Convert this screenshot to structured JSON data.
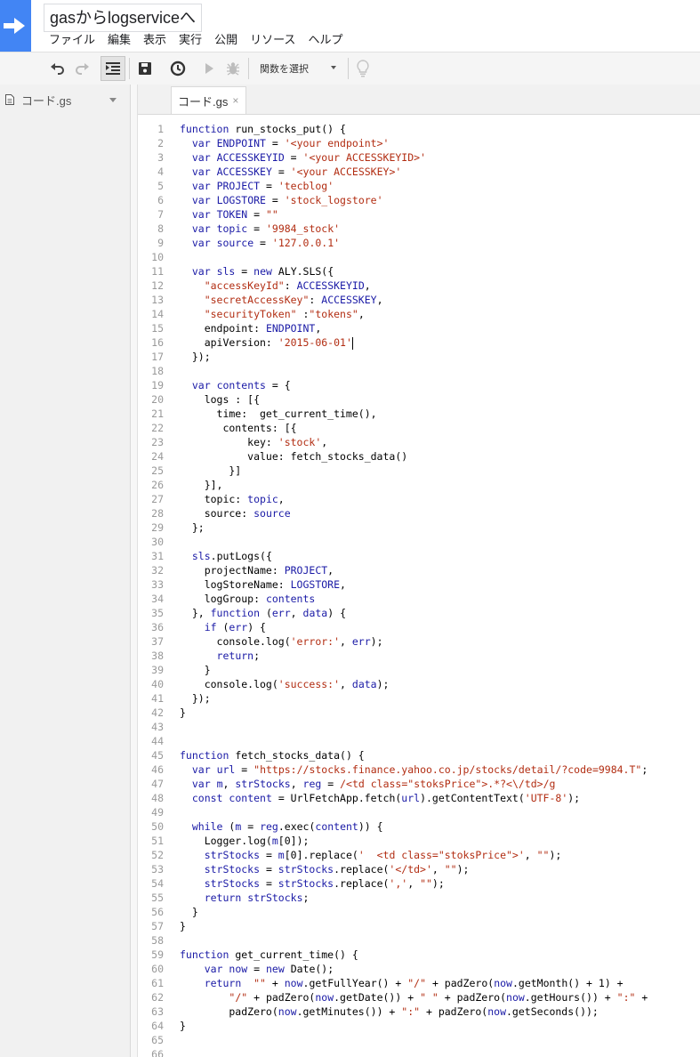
{
  "app": {
    "title": "gasからlogserviceへ",
    "menu": [
      "ファイル",
      "編集",
      "表示",
      "実行",
      "公開",
      "リソース",
      "ヘルプ"
    ]
  },
  "toolbar": {
    "function_select": "関数を選択"
  },
  "sidebar": {
    "files": [
      {
        "name": "コード.gs"
      }
    ]
  },
  "tabs": [
    {
      "label": "コード.gs",
      "close": "×"
    }
  ],
  "code": {
    "lines": [
      [
        [
          "k",
          "function"
        ],
        [
          "p",
          " run_stocks_put() {"
        ]
      ],
      [
        [
          "p",
          "  "
        ],
        [
          "k",
          "var"
        ],
        [
          "p",
          " "
        ],
        [
          "v",
          "ENDPOINT"
        ],
        [
          "p",
          " = "
        ],
        [
          "s",
          "'<your endpoint>'"
        ]
      ],
      [
        [
          "p",
          "  "
        ],
        [
          "k",
          "var"
        ],
        [
          "p",
          " "
        ],
        [
          "v",
          "ACCESSKEYID"
        ],
        [
          "p",
          " = "
        ],
        [
          "s",
          "'<your ACCESSKEYID>'"
        ]
      ],
      [
        [
          "p",
          "  "
        ],
        [
          "k",
          "var"
        ],
        [
          "p",
          " "
        ],
        [
          "v",
          "ACCESSKEY"
        ],
        [
          "p",
          " = "
        ],
        [
          "s",
          "'<your ACCESSKEY>'"
        ]
      ],
      [
        [
          "p",
          "  "
        ],
        [
          "k",
          "var"
        ],
        [
          "p",
          " "
        ],
        [
          "v",
          "PROJECT"
        ],
        [
          "p",
          " = "
        ],
        [
          "s",
          "'tecblog'"
        ]
      ],
      [
        [
          "p",
          "  "
        ],
        [
          "k",
          "var"
        ],
        [
          "p",
          " "
        ],
        [
          "v",
          "LOGSTORE"
        ],
        [
          "p",
          " = "
        ],
        [
          "s",
          "'stock_logstore'"
        ]
      ],
      [
        [
          "p",
          "  "
        ],
        [
          "k",
          "var"
        ],
        [
          "p",
          " "
        ],
        [
          "v",
          "TOKEN"
        ],
        [
          "p",
          " = "
        ],
        [
          "s",
          "\"\""
        ]
      ],
      [
        [
          "p",
          "  "
        ],
        [
          "k",
          "var"
        ],
        [
          "p",
          " "
        ],
        [
          "v",
          "topic"
        ],
        [
          "p",
          " = "
        ],
        [
          "s",
          "'9984_stock'"
        ]
      ],
      [
        [
          "p",
          "  "
        ],
        [
          "k",
          "var"
        ],
        [
          "p",
          " "
        ],
        [
          "v",
          "source"
        ],
        [
          "p",
          " = "
        ],
        [
          "s",
          "'127.0.0.1'"
        ]
      ],
      [],
      [
        [
          "p",
          "  "
        ],
        [
          "k",
          "var"
        ],
        [
          "p",
          " "
        ],
        [
          "v",
          "sls"
        ],
        [
          "p",
          " = "
        ],
        [
          "k",
          "new"
        ],
        [
          "p",
          " ALY.SLS({"
        ]
      ],
      [
        [
          "p",
          "    "
        ],
        [
          "s",
          "\"accessKeyId\""
        ],
        [
          "p",
          ": "
        ],
        [
          "v",
          "ACCESSKEYID"
        ],
        [
          "p",
          ","
        ]
      ],
      [
        [
          "p",
          "    "
        ],
        [
          "s",
          "\"secretAccessKey\""
        ],
        [
          "p",
          ": "
        ],
        [
          "v",
          "ACCESSKEY"
        ],
        [
          "p",
          ","
        ]
      ],
      [
        [
          "p",
          "    "
        ],
        [
          "s",
          "\"securityToken\""
        ],
        [
          "p",
          " :"
        ],
        [
          "s",
          "\"tokens\""
        ],
        [
          "p",
          ","
        ]
      ],
      [
        [
          "p",
          "    endpoint: "
        ],
        [
          "v",
          "ENDPOINT"
        ],
        [
          "p",
          ","
        ]
      ],
      [
        [
          "p",
          "    apiVersion: "
        ],
        [
          "s",
          "'2015-06-01'"
        ],
        [
          "c",
          ""
        ]
      ],
      [
        [
          "p",
          "  });"
        ]
      ],
      [],
      [
        [
          "p",
          "  "
        ],
        [
          "k",
          "var"
        ],
        [
          "p",
          " "
        ],
        [
          "v",
          "contents"
        ],
        [
          "p",
          " = {"
        ]
      ],
      [
        [
          "p",
          "    logs : [{"
        ]
      ],
      [
        [
          "p",
          "      time:  get_current_time(),"
        ]
      ],
      [
        [
          "p",
          "       contents: [{"
        ]
      ],
      [
        [
          "p",
          "           key: "
        ],
        [
          "s",
          "'stock'"
        ],
        [
          "p",
          ","
        ]
      ],
      [
        [
          "p",
          "           value: fetch_stocks_data()"
        ]
      ],
      [
        [
          "p",
          "        }]"
        ]
      ],
      [
        [
          "p",
          "    }],"
        ]
      ],
      [
        [
          "p",
          "    topic: "
        ],
        [
          "v",
          "topic"
        ],
        [
          "p",
          ","
        ]
      ],
      [
        [
          "p",
          "    source: "
        ],
        [
          "v",
          "source"
        ]
      ],
      [
        [
          "p",
          "  };"
        ]
      ],
      [],
      [
        [
          "p",
          "  "
        ],
        [
          "v",
          "sls"
        ],
        [
          "p",
          ".putLogs({"
        ]
      ],
      [
        [
          "p",
          "    projectName: "
        ],
        [
          "v",
          "PROJECT"
        ],
        [
          "p",
          ","
        ]
      ],
      [
        [
          "p",
          "    logStoreName: "
        ],
        [
          "v",
          "LOGSTORE"
        ],
        [
          "p",
          ","
        ]
      ],
      [
        [
          "p",
          "    logGroup: "
        ],
        [
          "v",
          "contents"
        ]
      ],
      [
        [
          "p",
          "  }, "
        ],
        [
          "k",
          "function"
        ],
        [
          "p",
          " ("
        ],
        [
          "v",
          "err"
        ],
        [
          "p",
          ", "
        ],
        [
          "v",
          "data"
        ],
        [
          "p",
          ") {"
        ]
      ],
      [
        [
          "p",
          "    "
        ],
        [
          "k",
          "if"
        ],
        [
          "p",
          " ("
        ],
        [
          "v",
          "err"
        ],
        [
          "p",
          ") {"
        ]
      ],
      [
        [
          "p",
          "      console.log("
        ],
        [
          "s",
          "'error:'"
        ],
        [
          "p",
          ", "
        ],
        [
          "v",
          "err"
        ],
        [
          "p",
          ");"
        ]
      ],
      [
        [
          "p",
          "      "
        ],
        [
          "k",
          "return"
        ],
        [
          "p",
          ";"
        ]
      ],
      [
        [
          "p",
          "    }"
        ]
      ],
      [
        [
          "p",
          "    console.log("
        ],
        [
          "s",
          "'success:'"
        ],
        [
          "p",
          ", "
        ],
        [
          "v",
          "data"
        ],
        [
          "p",
          ");"
        ]
      ],
      [
        [
          "p",
          "  });"
        ]
      ],
      [
        [
          "p",
          "}"
        ]
      ],
      [],
      [],
      [
        [
          "k",
          "function"
        ],
        [
          "p",
          " fetch_stocks_data() {"
        ]
      ],
      [
        [
          "p",
          "  "
        ],
        [
          "k",
          "var"
        ],
        [
          "p",
          " "
        ],
        [
          "v",
          "url"
        ],
        [
          "p",
          " = "
        ],
        [
          "s",
          "\"https://stocks.finance.yahoo.co.jp/stocks/detail/?code=9984.T\""
        ],
        [
          "p",
          ";"
        ]
      ],
      [
        [
          "p",
          "  "
        ],
        [
          "k",
          "var"
        ],
        [
          "p",
          " "
        ],
        [
          "v",
          "m"
        ],
        [
          "p",
          ", "
        ],
        [
          "v",
          "strStocks"
        ],
        [
          "p",
          ", "
        ],
        [
          "v",
          "reg"
        ],
        [
          "p",
          " = "
        ],
        [
          "s",
          "/<td class=\"stoksPrice\">.*?<\\/td>/g"
        ]
      ],
      [
        [
          "p",
          "  "
        ],
        [
          "k",
          "const"
        ],
        [
          "p",
          " "
        ],
        [
          "v",
          "content"
        ],
        [
          "p",
          " = UrlFetchApp.fetch("
        ],
        [
          "v",
          "url"
        ],
        [
          "p",
          ").getContentText("
        ],
        [
          "s",
          "'UTF-8'"
        ],
        [
          "p",
          ");"
        ]
      ],
      [],
      [
        [
          "p",
          "  "
        ],
        [
          "k",
          "while"
        ],
        [
          "p",
          " ("
        ],
        [
          "v",
          "m"
        ],
        [
          "p",
          " = "
        ],
        [
          "v",
          "reg"
        ],
        [
          "p",
          ".exec("
        ],
        [
          "v",
          "content"
        ],
        [
          "p",
          ")) {"
        ]
      ],
      [
        [
          "p",
          "    Logger.log("
        ],
        [
          "v",
          "m"
        ],
        [
          "p",
          "[0]);"
        ]
      ],
      [
        [
          "p",
          "    "
        ],
        [
          "v",
          "strStocks"
        ],
        [
          "p",
          " = "
        ],
        [
          "v",
          "m"
        ],
        [
          "p",
          "[0].replace("
        ],
        [
          "s",
          "'  <td class=\"stoksPrice\">'"
        ],
        [
          "p",
          ", "
        ],
        [
          "s",
          "\"\""
        ],
        [
          "p",
          ");"
        ]
      ],
      [
        [
          "p",
          "    "
        ],
        [
          "v",
          "strStocks"
        ],
        [
          "p",
          " = "
        ],
        [
          "v",
          "strStocks"
        ],
        [
          "p",
          ".replace("
        ],
        [
          "s",
          "'</td>'"
        ],
        [
          "p",
          ", "
        ],
        [
          "s",
          "\"\""
        ],
        [
          "p",
          ");"
        ]
      ],
      [
        [
          "p",
          "    "
        ],
        [
          "v",
          "strStocks"
        ],
        [
          "p",
          " = "
        ],
        [
          "v",
          "strStocks"
        ],
        [
          "p",
          ".replace("
        ],
        [
          "s",
          "','"
        ],
        [
          "p",
          ", "
        ],
        [
          "s",
          "\"\""
        ],
        [
          "p",
          ");"
        ]
      ],
      [
        [
          "p",
          "    "
        ],
        [
          "k",
          "return"
        ],
        [
          "p",
          " "
        ],
        [
          "v",
          "strStocks"
        ],
        [
          "p",
          ";"
        ]
      ],
      [
        [
          "p",
          "  }"
        ]
      ],
      [
        [
          "p",
          "}"
        ]
      ],
      [],
      [
        [
          "k",
          "function"
        ],
        [
          "p",
          " get_current_time() {"
        ]
      ],
      [
        [
          "p",
          "    "
        ],
        [
          "k",
          "var"
        ],
        [
          "p",
          " "
        ],
        [
          "v",
          "now"
        ],
        [
          "p",
          " = "
        ],
        [
          "k",
          "new"
        ],
        [
          "p",
          " Date();"
        ]
      ],
      [
        [
          "p",
          "    "
        ],
        [
          "k",
          "return"
        ],
        [
          "p",
          "  "
        ],
        [
          "s",
          "\"\""
        ],
        [
          "p",
          " + "
        ],
        [
          "v",
          "now"
        ],
        [
          "p",
          ".getFullYear() + "
        ],
        [
          "s",
          "\"/\""
        ],
        [
          "p",
          " + padZero("
        ],
        [
          "v",
          "now"
        ],
        [
          "p",
          ".getMonth() + 1) +"
        ]
      ],
      [
        [
          "p",
          "        "
        ],
        [
          "s",
          "\"/\""
        ],
        [
          "p",
          " + padZero("
        ],
        [
          "v",
          "now"
        ],
        [
          "p",
          ".getDate()) + "
        ],
        [
          "s",
          "\" \""
        ],
        [
          "p",
          " + padZero("
        ],
        [
          "v",
          "now"
        ],
        [
          "p",
          ".getHours()) + "
        ],
        [
          "s",
          "\":\""
        ],
        [
          "p",
          " +"
        ]
      ],
      [
        [
          "p",
          "        padZero("
        ],
        [
          "v",
          "now"
        ],
        [
          "p",
          ".getMinutes()) + "
        ],
        [
          "s",
          "\":\""
        ],
        [
          "p",
          " + padZero("
        ],
        [
          "v",
          "now"
        ],
        [
          "p",
          ".getSeconds());"
        ]
      ],
      [
        [
          "p",
          "}"
        ]
      ],
      [],
      []
    ]
  }
}
